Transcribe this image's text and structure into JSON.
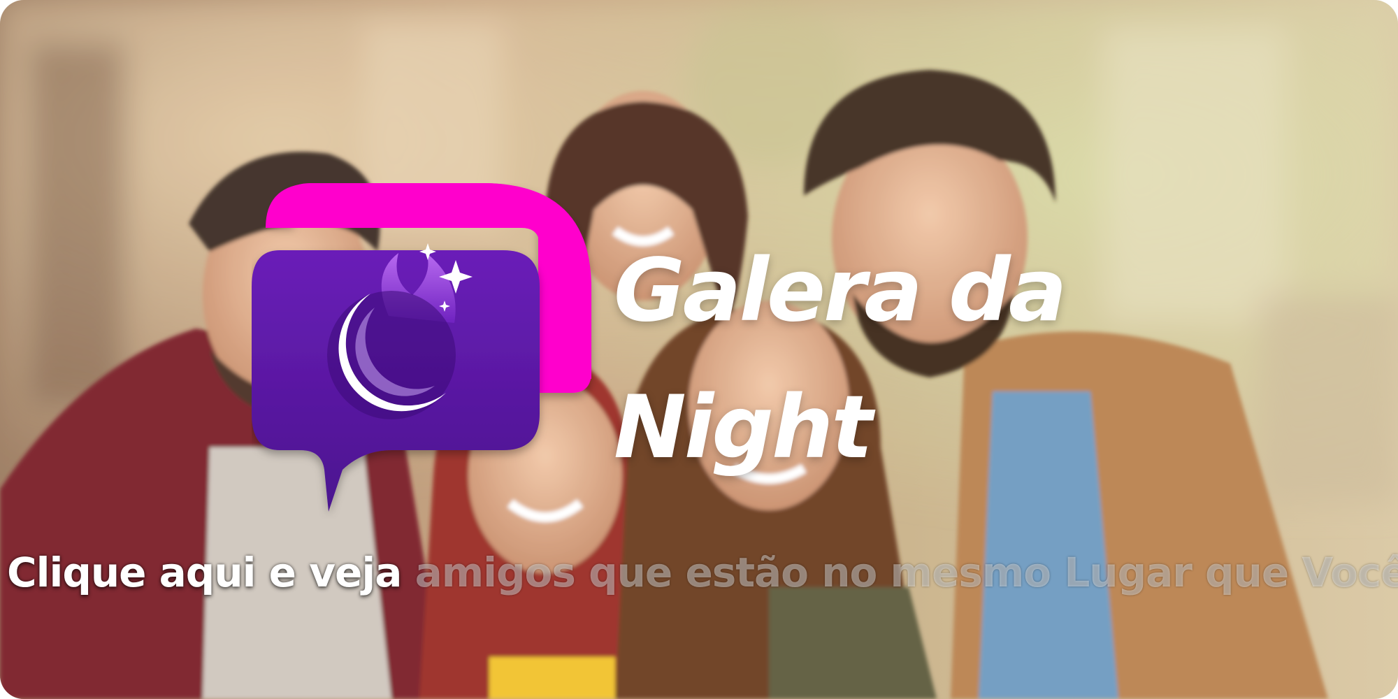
{
  "banner": {
    "title_line1": "Galera da",
    "title_line2": "Night",
    "cta_strong": "Clique aqui e veja",
    "cta_faded": " amigos que estão no mesmo Lugar que Você"
  },
  "logo": {
    "icon": "chat-bubble-moon-icon",
    "back_bubble_color": "#ff00cc",
    "front_bubble_color": "#5b1aa8",
    "moon_color": "#ffffff",
    "flame_color": "#a34de0",
    "star_color": "#ffffff"
  },
  "colors": {
    "title": "#ffffff",
    "cta": "#ffffff"
  }
}
